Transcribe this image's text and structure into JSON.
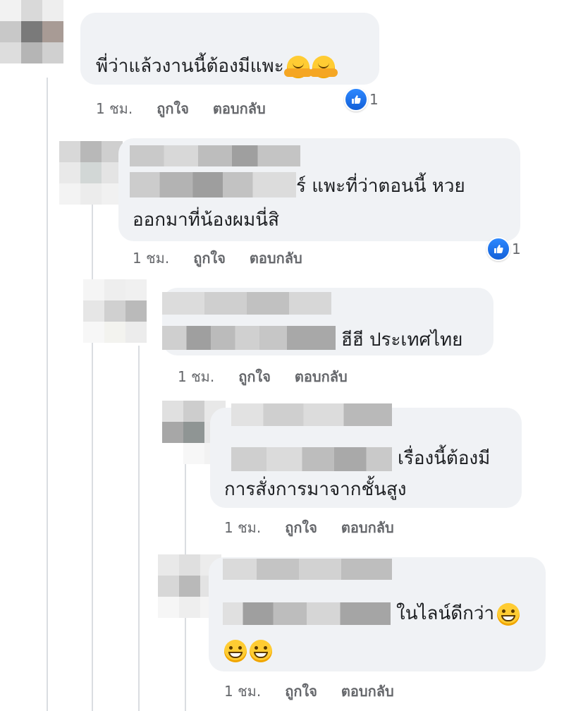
{
  "comments": [
    {
      "text": "พี่ว่าแล้วงานนี้ต้องมีแพะ",
      "emojis": [
        "hug-emoji",
        "hug-emoji"
      ],
      "time": "1 ชม.",
      "like_label": "ถูกใจ",
      "reply_label": "ตอบกลับ",
      "reaction_count": "1"
    },
    {
      "text_line1": "ร์ แพะที่ว่าตอนนี้ หวย",
      "text_line2": "ออกมาที่น้องผมนี่สิ",
      "time": "1 ชม.",
      "like_label": "ถูกใจ",
      "reply_label": "ตอบกลับ",
      "reaction_count": "1"
    },
    {
      "text": "ฮีฮี ประเทศไทย",
      "time": "1 ชม.",
      "like_label": "ถูกใจ",
      "reply_label": "ตอบกลับ"
    },
    {
      "text_line1": "เรื่องนี้ต้องมี",
      "text_line2": "การสั่งการมาจากชั้นสูง",
      "time": "1 ชม.",
      "like_label": "ถูกใจ",
      "reply_label": "ตอบกลับ"
    },
    {
      "text_line1": "ในไลน์ดีกว่า",
      "emojis": [
        "grin-emoji",
        "grin-emoji",
        "grin-emoji"
      ],
      "time": "1 ชม.",
      "like_label": "ถูกใจ",
      "reply_label": "ตอบกลับ"
    }
  ],
  "colors": {
    "bubble": "#f0f2f5",
    "like_blue": "#1877f2",
    "meta_text": "#65676b"
  }
}
